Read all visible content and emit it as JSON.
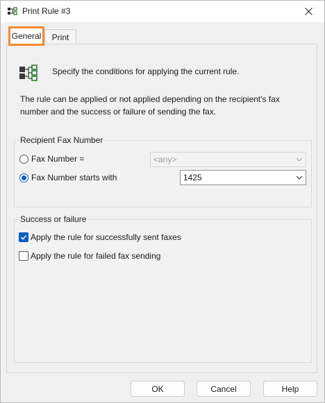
{
  "window": {
    "title": "Print Rule #3"
  },
  "tabs": [
    {
      "label": "General",
      "selected": true
    },
    {
      "label": "Print",
      "selected": false
    }
  ],
  "intro": "Specify the conditions for applying the current rule.",
  "description": "The rule can be applied or not applied depending on the recipient's fax number and the success or failure of sending the fax.",
  "recipient": {
    "title": "Recipient Fax Number",
    "option_equals": {
      "label": "Fax Number =",
      "selected": false,
      "value": "<any>",
      "enabled": false
    },
    "option_starts": {
      "label": "Fax Number starts with",
      "selected": true,
      "value": "1425",
      "enabled": true
    }
  },
  "outcome": {
    "title": "Success or failure",
    "success": {
      "label": "Apply the rule for successfully sent faxes",
      "checked": true
    },
    "failure": {
      "label": "Apply the rule for failed fax sending",
      "checked": false
    }
  },
  "buttons": {
    "ok": "OK",
    "cancel": "Cancel",
    "help": "Help"
  },
  "colors": {
    "accent": "#0a5fc4",
    "tab_highlight": "#f28b2f",
    "icon_green": "#2e7d32"
  },
  "icons": {
    "app": "rule-tree-icon",
    "close": "close-icon",
    "dropdown": "chevron-down-icon"
  }
}
